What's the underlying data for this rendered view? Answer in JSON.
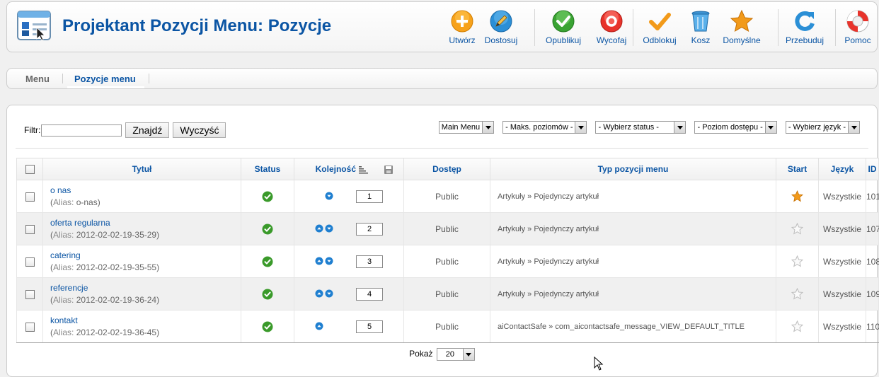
{
  "header": {
    "title": "Projektant Pozycji Menu: Pozycje",
    "buttons": [
      {
        "label": "Utwórz",
        "icon": "new-icon"
      },
      {
        "label": "Dostosuj",
        "icon": "edit-icon"
      },
      {
        "label": "Opublikuj",
        "icon": "publish-icon"
      },
      {
        "label": "Wycofaj",
        "icon": "unpublish-icon"
      },
      {
        "label": "Odblokuj",
        "icon": "checkin-icon"
      },
      {
        "label": "Kosz",
        "icon": "trash-icon"
      },
      {
        "label": "Domyślne",
        "icon": "default-star-icon"
      },
      {
        "label": "Przebuduj",
        "icon": "rebuild-icon"
      },
      {
        "label": "Pomoc",
        "icon": "help-icon"
      }
    ]
  },
  "submenu": {
    "items": [
      {
        "label": "Menu",
        "active": false
      },
      {
        "label": "Pozycje menu",
        "active": true
      }
    ]
  },
  "filter": {
    "label": "Filtr:",
    "value": "",
    "search_button": "Znajdź",
    "clear_button": "Wyczyść",
    "selects": [
      "Main Menu",
      "- Maks. poziomów -",
      "- Wybierz status -",
      "- Poziom dostępu -",
      "- Wybierz język -"
    ]
  },
  "table": {
    "headers": {
      "title": "Tytuł",
      "status": "Status",
      "ordering": "Kolejność",
      "access": "Dostęp",
      "type": "Typ pozycji menu",
      "home": "Start",
      "language": "Język",
      "id": "ID"
    },
    "alias_label": "Alias:",
    "rows": [
      {
        "title": "o nas",
        "alias": "o-nas",
        "order": "1",
        "access": "Public",
        "type": "Artykuły » Pojedynczy artykuł",
        "home": true,
        "language": "Wszystkie",
        "id": "101",
        "up": false,
        "down": true
      },
      {
        "title": "oferta regularna",
        "alias": "2012-02-02-19-35-29",
        "order": "2",
        "access": "Public",
        "type": "Artykuły » Pojedynczy artykuł",
        "home": false,
        "language": "Wszystkie",
        "id": "107",
        "up": true,
        "down": true
      },
      {
        "title": "catering",
        "alias": "2012-02-02-19-35-55",
        "order": "3",
        "access": "Public",
        "type": "Artykuły » Pojedynczy artykuł",
        "home": false,
        "language": "Wszystkie",
        "id": "108",
        "up": true,
        "down": true
      },
      {
        "title": "referencje",
        "alias": "2012-02-02-19-36-24",
        "order": "4",
        "access": "Public",
        "type": "Artykuły » Pojedynczy artykuł",
        "home": false,
        "language": "Wszystkie",
        "id": "109",
        "up": true,
        "down": true
      },
      {
        "title": "kontakt",
        "alias": "2012-02-02-19-36-45",
        "order": "5",
        "access": "Public",
        "type": "aiContactSafe » com_aicontactsafe_message_VIEW_DEFAULT_TITLE",
        "home": false,
        "language": "Wszystkie",
        "id": "110",
        "up": true,
        "down": false
      }
    ]
  },
  "pagination": {
    "label": "Pokaż",
    "value": "20"
  }
}
